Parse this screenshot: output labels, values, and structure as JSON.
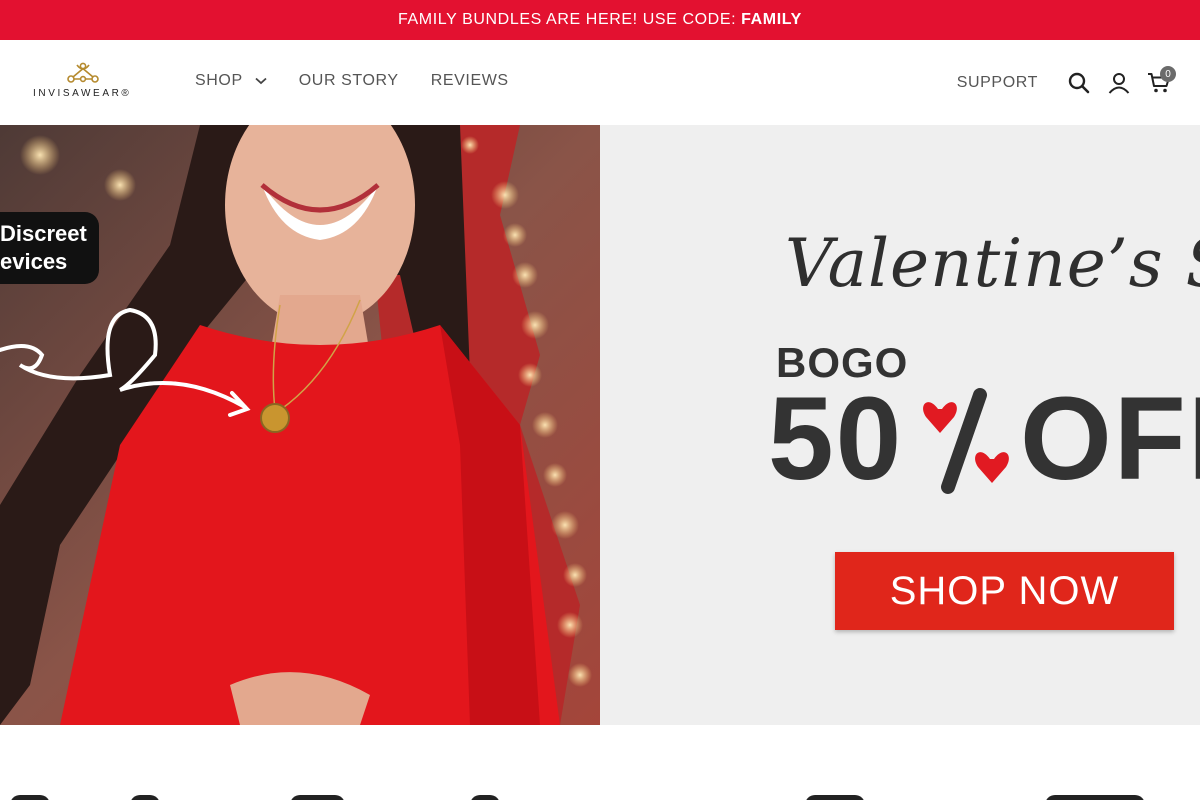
{
  "announcement": {
    "text": "FAMILY BUNDLES ARE HERE! USE CODE:",
    "code": "FAMILY",
    "bg_color": "#e31130"
  },
  "header": {
    "logo_text": "INVISAWEAR",
    "logo_mark": "®",
    "nav": [
      {
        "label": "SHOP",
        "has_dropdown": true
      },
      {
        "label": "OUR STORY"
      },
      {
        "label": "REVIEWS"
      }
    ],
    "support_label": "SUPPORT",
    "icons": [
      "search-icon",
      "account-icon",
      "cart-icon"
    ],
    "cart_count": "0"
  },
  "hero": {
    "photo_tag_line1": "Discreet",
    "photo_tag_line2": "evices",
    "title": "Valentine’s Sale",
    "bogo": "BOGO",
    "discount_number": "50",
    "percent_symbol": "%",
    "off_text": "OFF",
    "cta_label": "SHOP NOW",
    "accent_color": "#e0261b",
    "heart_color": "#e11a22"
  }
}
